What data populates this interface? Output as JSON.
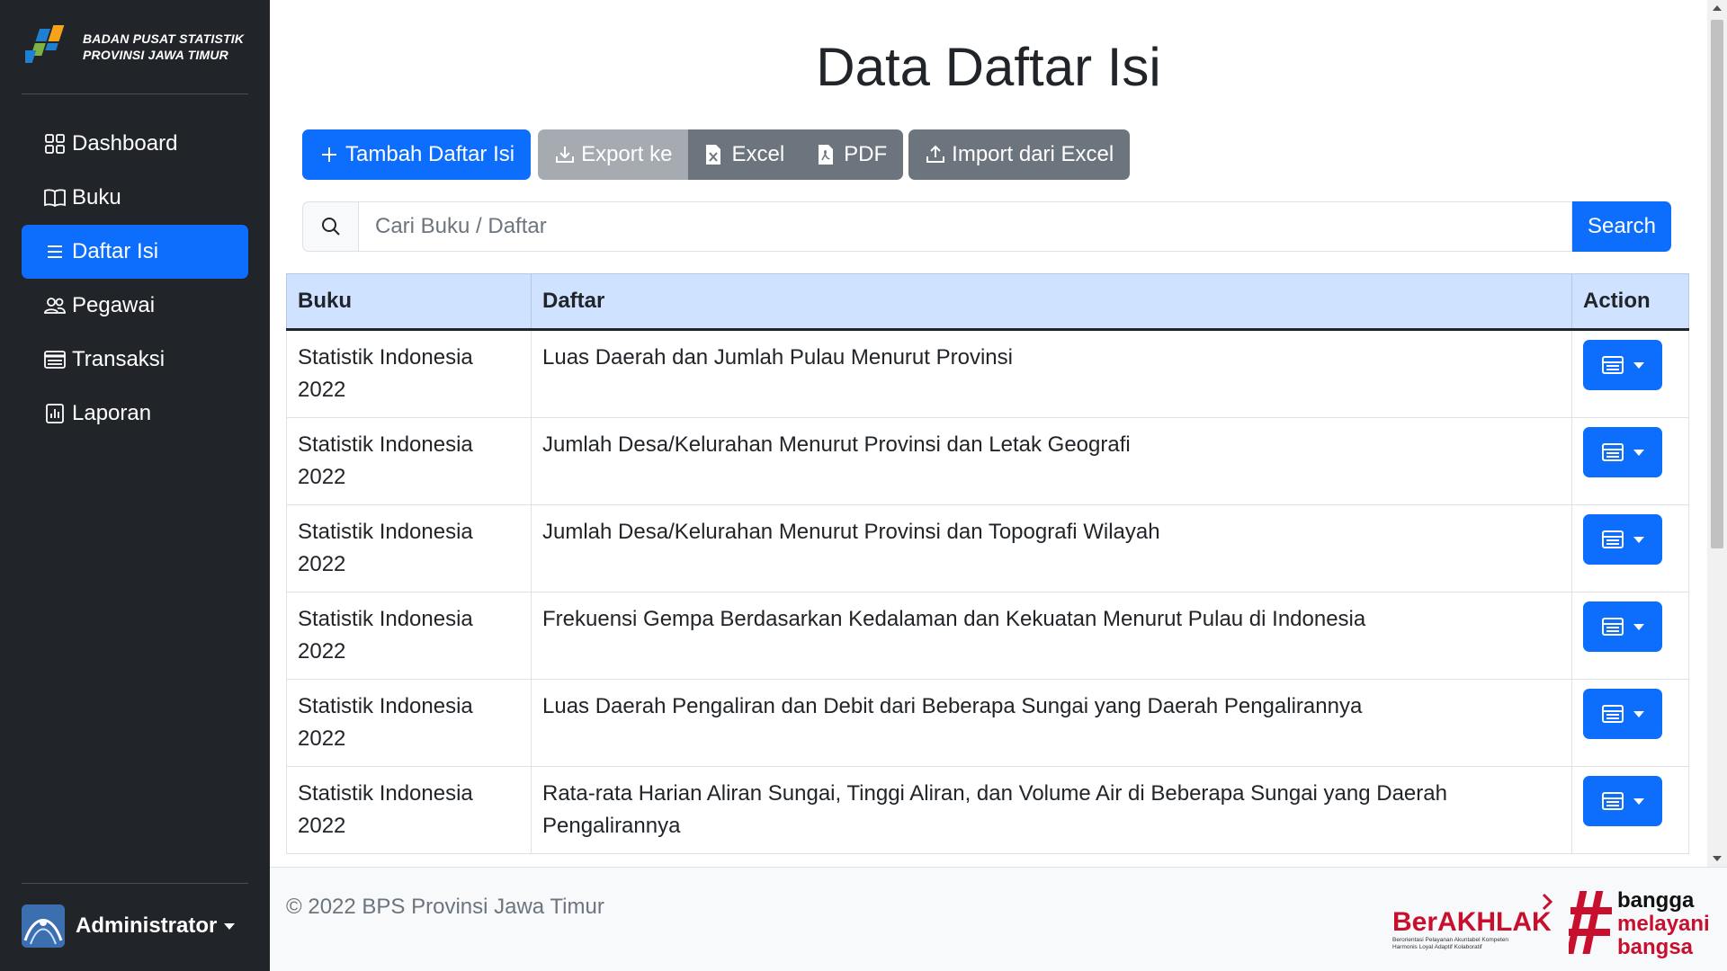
{
  "brand": {
    "line1": "BADAN PUSAT STATISTIK",
    "line2": "PROVINSI JAWA TIMUR"
  },
  "sidebar": {
    "items": [
      {
        "label": "Dashboard",
        "icon": "grid-icon",
        "active": false
      },
      {
        "label": "Buku",
        "icon": "book-icon",
        "active": false
      },
      {
        "label": "Daftar Isi",
        "icon": "list-icon",
        "active": true
      },
      {
        "label": "Pegawai",
        "icon": "people-icon",
        "active": false
      },
      {
        "label": "Transaksi",
        "icon": "credit-card-icon",
        "active": false
      },
      {
        "label": "Laporan",
        "icon": "bar-chart-icon",
        "active": false
      }
    ],
    "user": "Administrator"
  },
  "page": {
    "title": "Data Daftar Isi"
  },
  "toolbar": {
    "add_label": "Tambah Daftar Isi",
    "export_label": "Export ke",
    "excel_label": "Excel",
    "pdf_label": "PDF",
    "import_label": "Import dari Excel"
  },
  "search": {
    "placeholder": "Cari Buku / Daftar",
    "value": "",
    "button_label": "Search"
  },
  "table": {
    "headers": {
      "buku": "Buku",
      "daftar": "Daftar",
      "action": "Action"
    },
    "rows": [
      {
        "buku": "Statistik Indonesia 2022",
        "daftar": "Luas Daerah dan Jumlah Pulau Menurut Provinsi"
      },
      {
        "buku": "Statistik Indonesia 2022",
        "daftar": "Jumlah Desa/Kelurahan Menurut Provinsi dan Letak Geografi"
      },
      {
        "buku": "Statistik Indonesia 2022",
        "daftar": "Jumlah Desa/Kelurahan Menurut Provinsi dan Topografi Wilayah"
      },
      {
        "buku": "Statistik Indonesia 2022",
        "daftar": "Frekuensi Gempa Berdasarkan Kedalaman dan Kekuatan Menurut Pulau di Indonesia"
      },
      {
        "buku": "Statistik Indonesia 2022",
        "daftar": "Luas Daerah Pengaliran dan Debit dari Beberapa Sungai yang Daerah Pengalirannya"
      },
      {
        "buku": "Statistik Indonesia 2022",
        "daftar": "Rata-rata Harian Aliran Sungai, Tinggi Aliran, dan Volume Air di Beberapa Sungai yang Daerah Pengalirannya"
      }
    ]
  },
  "footer": {
    "copyright": "© 2022 BPS Provinsi Jawa Timur",
    "berakhlak": "BerAKHLAK",
    "berakhlak_sub1": "Berorientasi Pelayanan Akuntabel Kompeten",
    "berakhlak_sub2": "Harmonis Loyal Adaptif Kolaboratif",
    "bangga_1": "bangga",
    "bangga_2": "melayani",
    "bangga_3": "bangsa"
  },
  "colors": {
    "primary": "#0d6efd",
    "sidebar": "#212529",
    "secondary": "#6c757d",
    "table_header": "#cfe2ff",
    "brand_red": "#c8102e"
  }
}
